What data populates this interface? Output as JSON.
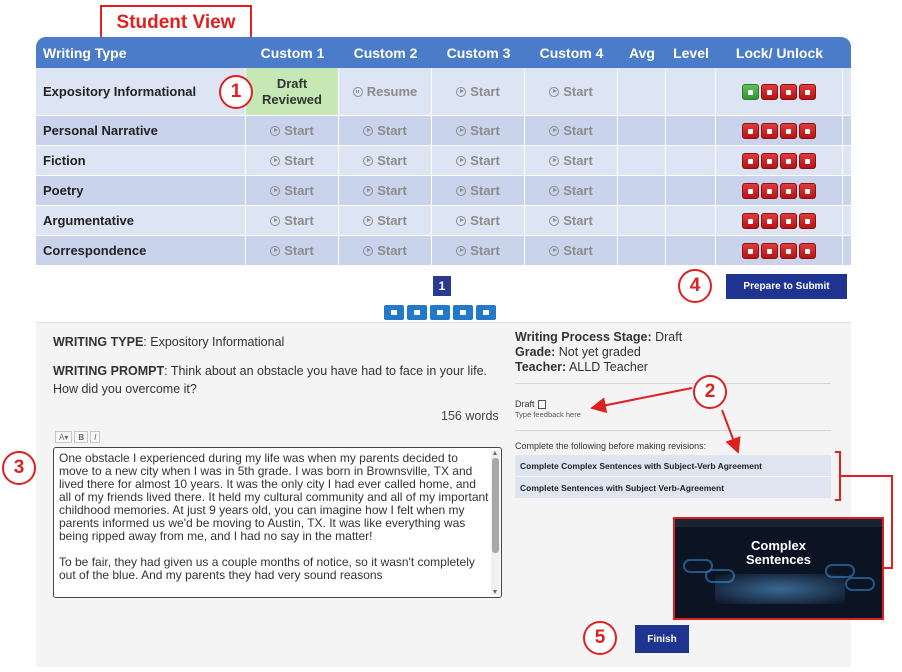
{
  "view_label": "Student View",
  "table": {
    "headers": [
      "Writing Type",
      "Custom 1",
      "Custom 2",
      "Custom 3",
      "Custom 4",
      "Avg",
      "Level",
      "Lock/ Unlock"
    ],
    "rows": [
      {
        "type": "Expository Informational",
        "c1_line1": "Draft",
        "c1_line2": "Reviewed",
        "c2": "Resume",
        "c3": "Start",
        "c4": "Start",
        "avg": "",
        "level": ""
      },
      {
        "type": "Personal Narrative",
        "c1": "Start",
        "c2": "Start",
        "c3": "Start",
        "c4": "Start",
        "avg": "",
        "level": ""
      },
      {
        "type": "Fiction",
        "c1": "Start",
        "c2": "Start",
        "c3": "Start",
        "c4": "Start",
        "avg": "",
        "level": ""
      },
      {
        "type": "Poetry",
        "c1": "Start",
        "c2": "Start",
        "c3": "Start",
        "c4": "Start",
        "avg": "",
        "level": ""
      },
      {
        "type": "Argumentative",
        "c1": "Start",
        "c2": "Start",
        "c3": "Start",
        "c4": "Start",
        "avg": "",
        "level": ""
      },
      {
        "type": "Correspondence",
        "c1": "Start",
        "c2": "Start",
        "c3": "Start",
        "c4": "Start",
        "avg": "",
        "level": ""
      }
    ]
  },
  "callouts": [
    "1",
    "2",
    "3",
    "4",
    "5"
  ],
  "pager": {
    "current": "1"
  },
  "prepare_button": "Prepare to Submit",
  "writing_type_label": "WRITING TYPE",
  "writing_type_value": ": Expository Informational",
  "writing_prompt_label": "WRITING PROMPT",
  "writing_prompt_value": ": Think about an obstacle you have had to face in your life. How did you overcome it?",
  "word_count": "156 words",
  "editor_tools": [
    "A▾",
    "B",
    "I"
  ],
  "essay_text": "One obstacle I experienced during my life was when my parents decided to move to a new city when I was in 5th grade. I was born in Brownsville, TX and lived there for almost 10 years. It was the only city I had ever called home, and all of my friends lived there. It held my cultural community and all of my important childhood memories. At just 9 years old, you can imagine how I felt when my parents informed us we'd be moving to Austin, TX. It was like everything was being ripped away from me, and I had no say in the matter!\n\nTo be fair, they had given us a couple months of notice, so it wasn't completely out of the blue. And my parents they had very sound reasons",
  "stage_label": "Writing Process Stage:",
  "stage_value": " Draft",
  "grade_label": "Grade:",
  "grade_value": " Not yet graded",
  "teacher_label": "Teacher:",
  "teacher_value": " ALLD Teacher",
  "draft_label": "Draft",
  "feedback_placeholder": "Type feedback here",
  "complete_label": "Complete the following before making revisions:",
  "tasks": [
    "Complete Complex Sentences with Subject-Verb Agreement",
    "Complete Sentences with Subject Verb-Agreement"
  ],
  "video_title_line1": "Complex",
  "video_title_line2": "Sentences",
  "finish_button": "Finish",
  "colors": {
    "header_blue": "#4a7cc9",
    "navy_button": "#1f3491",
    "callout_red": "#e02020",
    "reviewed_green": "#c6e8b4"
  }
}
